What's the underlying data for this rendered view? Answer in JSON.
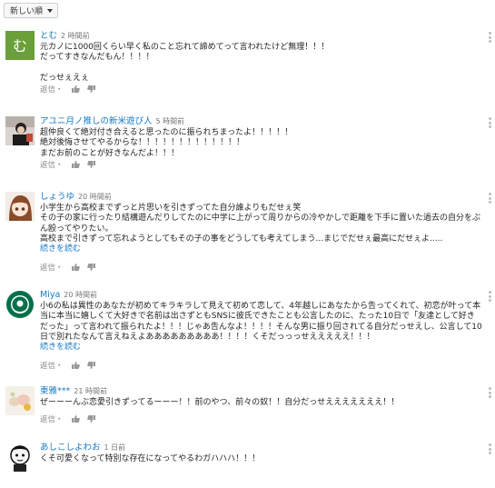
{
  "sort": {
    "label": "新しい順"
  },
  "comments": [
    {
      "author": "とむ",
      "time": "2 時間前",
      "avatar_letter": "む",
      "text": "元カノに1000回くらい早く私のこと忘れて諦めてって言われたけど無理！！！\nだってすきなんだもん！！！！\n\nだっせぇえぇ",
      "reply": "返信・",
      "read_more": ""
    },
    {
      "author": "アユニ月ノ推しの新米遊び人",
      "time": "5 時間前",
      "text": "超仲良くて絶対付き合えると思ったのに振られちまったよ！！！！！\n絶対後悔させてやるからな！！！！！！！！！！！！！\nまだお前のことが好きなんだよ！！！",
      "reply": "返信・",
      "read_more": ""
    },
    {
      "author": "しょうゆ",
      "time": "20 時間前",
      "text": "小学生から高校までずっと片思いを引きずってた自分誰よりもだせぇ笑\nその子の家に行ったり結構遊んだりしてたのに中学に上がって周りからの冷やかしで距離を下手に置いた過去の自分をぶん殴ってやりたい。\n高校まで引きずって忘れようとしてもその子の事をどうしても考えてしまう...まじでだせぇ最高にだせぇよ.....",
      "reply": "返信・",
      "read_more": "続きを読む"
    },
    {
      "author": "Miya",
      "time": "20 時間前",
      "text": "小6の私は異性のあなたが初めてキラキラして見えて初めて恋して、4年越しにあなたから告ってくれて、初恋が叶って本当に本当に嬉しくて大好きで名前は出さずともSNSに彼氏できたことも公言したのに、たった10日で「友達として好きだった」って言われて振られたよ！！！じゃあ告んなよ！！！！そんな男に振り回されてる自分だっせえし、公言して10日で別れたなんて言えねえよあああああああああ！！！！くそだっっっせえええええ！！！",
      "reply": "返信・",
      "read_more": "続きを読む"
    },
    {
      "author": "東雅***",
      "time": "21 時間前",
      "text": "ぜーーーんぶ恋愛引きずってるーーー！！前のやつ、前々の奴！！自分だっせえええええええ！！",
      "reply": "返信・",
      "read_more": ""
    },
    {
      "author": "あしこしよわお",
      "time": "1 日前",
      "text": "くそ可愛くなって特別な存在になってやるわガハハハ！！！",
      "reply": "",
      "read_more": ""
    }
  ],
  "colors": {
    "author": "#167ac6",
    "avatar_green": "#6b9f3a",
    "starbucks_green": "#00704a"
  },
  "icons": [
    "thumbs-up-icon",
    "thumbs-down-icon",
    "more-vert-icon"
  ]
}
